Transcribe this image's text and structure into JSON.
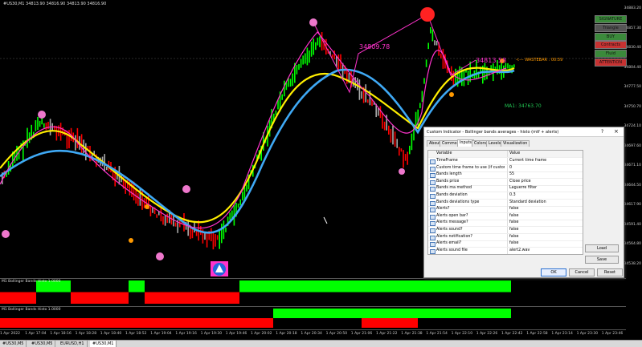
{
  "chart": {
    "symbol_info": "#US30,M1  34813.90 34816.90 34813.90 34816.90",
    "prices": [
      "34883.20",
      "34857.30",
      "34830.40",
      "34804.40",
      "34777.50",
      "34750.70",
      "34724.10",
      "34697.60",
      "34671.10",
      "34644.50",
      "34617.90",
      "34591.40",
      "34564.80",
      "34538.20"
    ],
    "labels": {
      "left_value": "34809.78",
      "right_value": "34813.58",
      "timer": "<--- WASTEBAR : 00:59",
      "ma_value": "MA1: 34763.70"
    },
    "side_buttons": [
      "SIGNATURE",
      "Triangle",
      "BUY",
      "Contracts",
      "Fluid",
      "ATTENTION"
    ],
    "side_button_colors": [
      "#3b8a3b",
      "#555555",
      "#3b8a3b",
      "#c73232",
      "#3b8a3b",
      "#c73232"
    ]
  },
  "indicators": [
    {
      "label": "M1 Bollinger Bands Histo 1.0000"
    },
    {
      "label": "M1 Bollinger Bands Histo 1.0000"
    }
  ],
  "time_axis": [
    "1 Apr 2022",
    "1 Apr 17:04",
    "1 Apr 18:16",
    "1 Apr 18:28",
    "1 Apr 18:40",
    "1 Apr 18:52",
    "1 Apr 19:04",
    "1 Apr 19:16",
    "1 Apr 19:30",
    "1 Apr 19:46",
    "1 Apr 20:02",
    "1 Apr 20:18",
    "1 Apr 20:34",
    "1 Apr 20:50",
    "1 Apr 21:06",
    "1 Apr 21:22",
    "1 Apr 21:38",
    "1 Apr 21:54",
    "1 Apr 22:10",
    "1 Apr 22:26",
    "1 Apr 22:42",
    "1 Apr 22:58",
    "1 Apr 23:14",
    "1 Apr 23:30",
    "1 Apr 23:46"
  ],
  "tabs": [
    {
      "label": "#US30,M5"
    },
    {
      "label": "#US30,M5"
    },
    {
      "label": "EURUSD,H1"
    },
    {
      "label": "#US30,M1"
    }
  ],
  "dialog": {
    "title": "Custom Indicator - Bollinger bands averages - histo (mtf + alerts)",
    "help": "?",
    "close": "×",
    "tabs": [
      "About",
      "Common",
      "Inputs",
      "Colors",
      "Levels",
      "Visualization"
    ],
    "active_tab": "Inputs",
    "columns": {
      "variable": "Variable",
      "value": "Value"
    },
    "rows": [
      {
        "name": "TimeFrame",
        "value": "Current time frame"
      },
      {
        "name": "Custom time frame to use (if custom time ...",
        "value": "0"
      },
      {
        "name": "Bands length",
        "value": "55"
      },
      {
        "name": "Bands price",
        "value": "Close price"
      },
      {
        "name": "Bands ma method",
        "value": "Laguerre filter"
      },
      {
        "name": "Bands deviation",
        "value": "0.3"
      },
      {
        "name": "Bands deviations type",
        "value": "Standard deviation"
      },
      {
        "name": "Alerts?",
        "value": "false"
      },
      {
        "name": "Alerts open bar?",
        "value": "false"
      },
      {
        "name": "Alerts message?",
        "value": "false"
      },
      {
        "name": "Alerts sound?",
        "value": "false"
      },
      {
        "name": "Alerts notification?",
        "value": "false"
      },
      {
        "name": "Alerts email?",
        "value": "false"
      },
      {
        "name": "Alerts sound file",
        "value": "alert2.wav"
      }
    ],
    "buttons": {
      "load": "Load",
      "save": "Save",
      "ok": "OK",
      "cancel": "Cancel",
      "reset": "Reset"
    }
  },
  "colors": {
    "bull": "#00ff00",
    "bear": "#ff0000",
    "yellow_line": "#ffee00",
    "blue_line": "#3fa9f5",
    "magenta_line": "#ff33cc",
    "dots": "#ee77cc"
  }
}
